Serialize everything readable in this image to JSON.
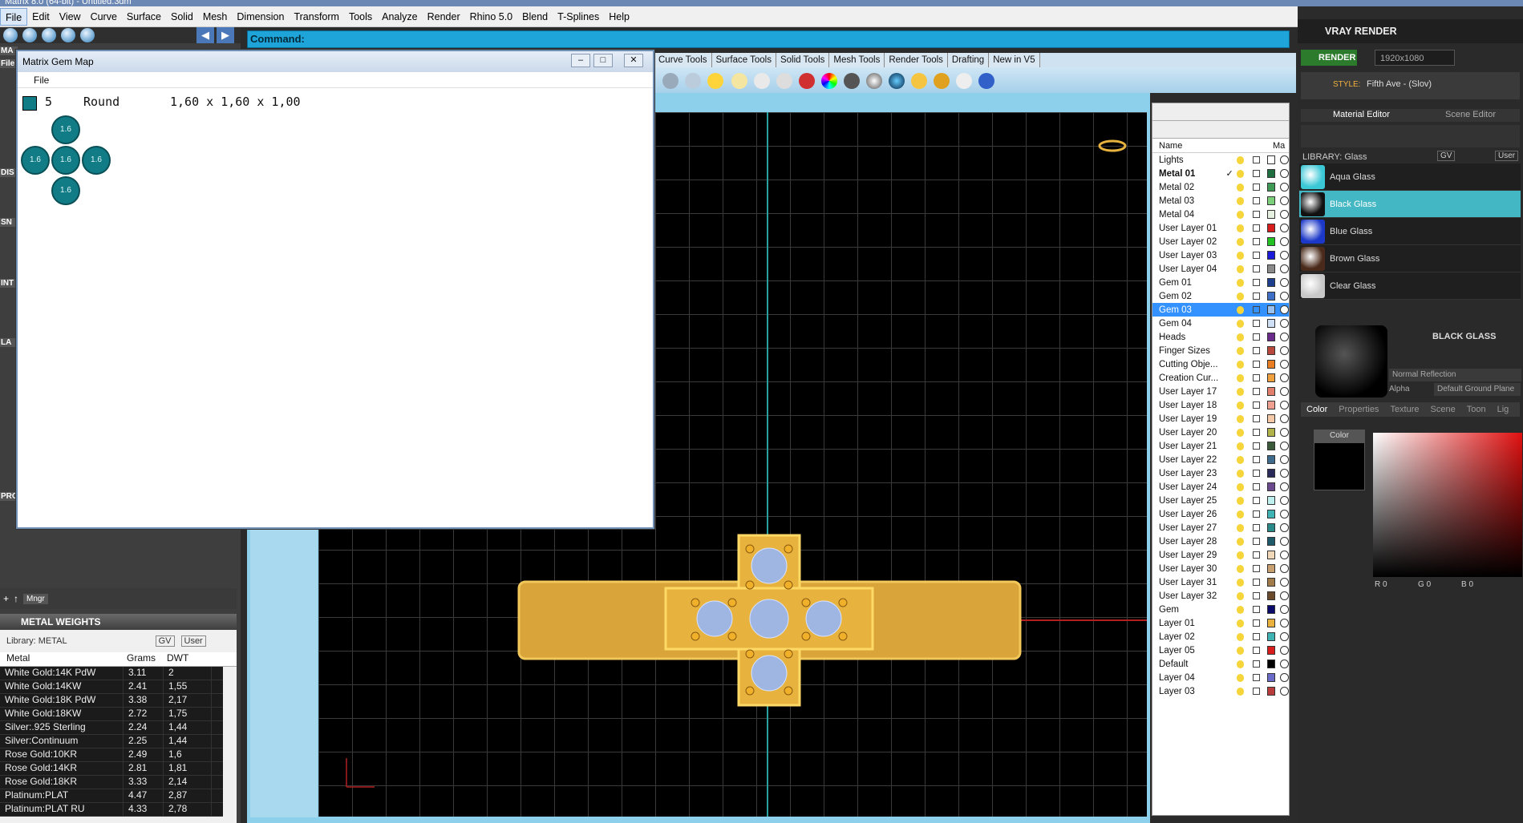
{
  "window": {
    "title": "Matrix 8.0 (64-bit) - Untitled.3dm"
  },
  "menu": [
    "File",
    "Edit",
    "View",
    "Curve",
    "Surface",
    "Solid",
    "Mesh",
    "Dimension",
    "Transform",
    "Tools",
    "Analyze",
    "Render",
    "Rhino 5.0",
    "Blend",
    "T-Splines",
    "Help"
  ],
  "command": {
    "label": "Command:"
  },
  "tool_tabs": [
    "Curve Tools",
    "Surface Tools",
    "Solid Tools",
    "Mesh Tools",
    "Render Tools",
    "Drafting",
    "New in V5"
  ],
  "gem_map": {
    "title": "Matrix Gem Map",
    "menu_file": "File",
    "count": "5",
    "shape": "Round",
    "dims": "1,60 x 1,60 x 1,00",
    "gem_label": "1.6"
  },
  "metal_weights": {
    "title": "METAL WEIGHTS",
    "library_label": "Library: METAL",
    "gv": "GV",
    "user": "User",
    "headers": [
      "Metal",
      "Grams",
      "DWT"
    ],
    "rows": [
      [
        "White Gold:14K PdW",
        "3.11",
        "2"
      ],
      [
        "White Gold:14KW",
        "2.41",
        "1,55"
      ],
      [
        "White Gold:18K PdW",
        "3.38",
        "2,17"
      ],
      [
        "White Gold:18KW",
        "2.72",
        "1,75"
      ],
      [
        "Silver:.925 Sterling",
        "2.24",
        "1,44"
      ],
      [
        "Silver:Continuum",
        "2.25",
        "1,44"
      ],
      [
        "Rose Gold:10KR",
        "2.49",
        "1,6"
      ],
      [
        "Rose Gold:14KR",
        "2.81",
        "1,81"
      ],
      [
        "Rose Gold:18KR",
        "3.33",
        "2,14"
      ],
      [
        "Platinum:PLAT",
        "4.47",
        "2,87"
      ],
      [
        "Platinum:PLAT RU",
        "4.33",
        "2,78"
      ]
    ],
    "mngr": "Mngr"
  },
  "layers": {
    "header_name": "Name",
    "header_ma": "Ma",
    "rows": [
      {
        "name": "Lights",
        "color": "#ffffff",
        "current": false
      },
      {
        "name": "Metal 01",
        "color": "#1f6e3f",
        "current": true
      },
      {
        "name": "Metal 02",
        "color": "#3f9a56",
        "current": false
      },
      {
        "name": "Metal 03",
        "color": "#7ccf7a",
        "current": false
      },
      {
        "name": "Metal 04",
        "color": "#e6f0e0",
        "current": false
      },
      {
        "name": "User Layer 01",
        "color": "#d81b1b",
        "current": false
      },
      {
        "name": "User Layer 02",
        "color": "#21c221",
        "current": false
      },
      {
        "name": "User Layer 03",
        "color": "#1a1ad8",
        "current": false
      },
      {
        "name": "User Layer 04",
        "color": "#8a8a8a",
        "current": false
      },
      {
        "name": "Gem 01",
        "color": "#1c3e8c",
        "current": false
      },
      {
        "name": "Gem 02",
        "color": "#3e6fc6",
        "current": false
      },
      {
        "name": "Gem 03",
        "color": "#9bc1ee",
        "current": false,
        "selected": true
      },
      {
        "name": "Gem 04",
        "color": "#cfe0f6",
        "current": false
      },
      {
        "name": "Heads",
        "color": "#6a2a8c",
        "current": false
      },
      {
        "name": "Finger Sizes",
        "color": "#b8473c",
        "current": false
      },
      {
        "name": "Cutting Obje...",
        "color": "#e87d22",
        "current": false
      },
      {
        "name": "Creation Cur...",
        "color": "#f0a03c",
        "current": false
      },
      {
        "name": "User Layer 17",
        "color": "#e07f6c",
        "current": false
      },
      {
        "name": "User Layer 18",
        "color": "#f0a090",
        "current": false
      },
      {
        "name": "User Layer 19",
        "color": "#f5c8a8",
        "current": false
      },
      {
        "name": "User Layer 20",
        "color": "#b2b24b",
        "current": false
      },
      {
        "name": "User Layer 21",
        "color": "#3a5a3a",
        "current": false
      },
      {
        "name": "User Layer 22",
        "color": "#3e6a8c",
        "current": false
      },
      {
        "name": "User Layer 23",
        "color": "#2a2a5a",
        "current": false
      },
      {
        "name": "User Layer 24",
        "color": "#6a4a8c",
        "current": false
      },
      {
        "name": "User Layer 25",
        "color": "#bff0f0",
        "current": false
      },
      {
        "name": "User Layer 26",
        "color": "#3fb3b3",
        "current": false
      },
      {
        "name": "User Layer 27",
        "color": "#2a8a8a",
        "current": false
      },
      {
        "name": "User Layer 28",
        "color": "#1f5a6a",
        "current": false
      },
      {
        "name": "User Layer 29",
        "color": "#f0d8b8",
        "current": false
      },
      {
        "name": "User Layer 30",
        "color": "#c8a070",
        "current": false
      },
      {
        "name": "User Layer 31",
        "color": "#a07a48",
        "current": false
      },
      {
        "name": "User Layer 32",
        "color": "#6a4a2a",
        "current": false
      },
      {
        "name": "Gem",
        "color": "#0a0a6a",
        "current": false
      },
      {
        "name": "Layer 01",
        "color": "#e8b03c",
        "current": false
      },
      {
        "name": "Layer 02",
        "color": "#3fb3b3",
        "current": false
      },
      {
        "name": "Layer 05",
        "color": "#d81b1b",
        "current": false
      },
      {
        "name": "Default",
        "color": "#000000",
        "current": false
      },
      {
        "name": "Layer 04",
        "color": "#6a6ac8",
        "current": false
      },
      {
        "name": "Layer 03",
        "color": "#b83c3c",
        "current": false
      }
    ]
  },
  "vray": {
    "title": "VRAY RENDER",
    "render_button": "RENDER",
    "resolution": "1920x1080",
    "style_label": "STYLE:",
    "style_value": "Fifth Ave - (Slov)",
    "tab_material_editor": "Material Editor",
    "tab_scene_editor": "Scene Editor",
    "library_label": "LIBRARY: Glass",
    "gv": "GV",
    "user": "User",
    "materials": [
      {
        "name": "Aqua Glass",
        "color": "#3ac7d6"
      },
      {
        "name": "Black Glass",
        "color": "#111111"
      },
      {
        "name": "Blue Glass",
        "color": "#1c38c8"
      },
      {
        "name": "Brown Glass",
        "color": "#4a2a1a"
      },
      {
        "name": "Clear Glass",
        "color": "#c8c8c8"
      }
    ],
    "selected_material": "BLACK GLASS",
    "normal_reflection": "Normal Reflection",
    "alpha": "Alpha",
    "ground_plane": "Default Ground Plane",
    "subtabs": [
      "Color",
      "Properties",
      "Texture",
      "Scene",
      "Toon",
      "Lig"
    ],
    "color_label": "Color",
    "rgb": {
      "R": "0",
      "G": "0",
      "B": "0"
    }
  },
  "left_labels": [
    "MA",
    "File",
    "DIS",
    "SN",
    "INT",
    "LA",
    "PRO"
  ]
}
